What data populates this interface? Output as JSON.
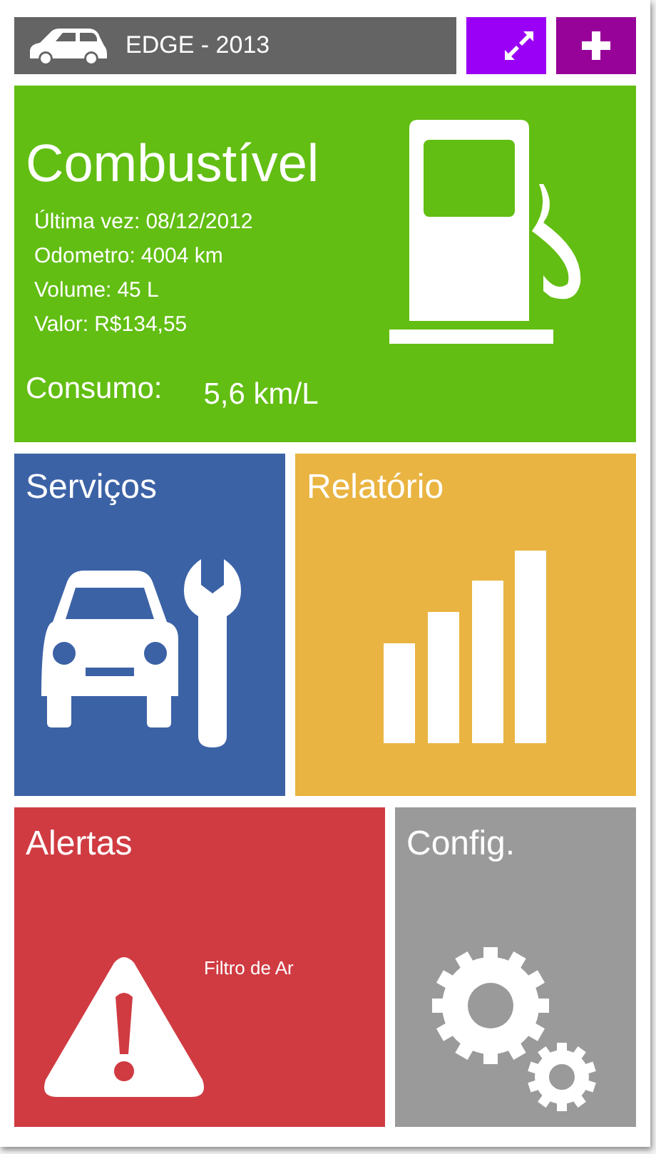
{
  "header": {
    "vehicle": "EDGE - 2013"
  },
  "fuel": {
    "title": "Combustível",
    "rows": [
      {
        "label": "Última vez:",
        "value": "08/12/2012"
      },
      {
        "label": "Odometro:",
        "value": "4004 km"
      },
      {
        "label": "Volume:",
        "value": "45 L"
      },
      {
        "label": "Valor:",
        "value": "R$134,55"
      }
    ],
    "consumption_label": "Consumo:",
    "consumption_value": "5,6 km/L"
  },
  "services": {
    "title": "Serviços"
  },
  "report": {
    "title": "Relatório"
  },
  "alerts": {
    "title": "Alertas",
    "items": [
      "Filtro de Ar"
    ]
  },
  "settings": {
    "title": "Config."
  }
}
